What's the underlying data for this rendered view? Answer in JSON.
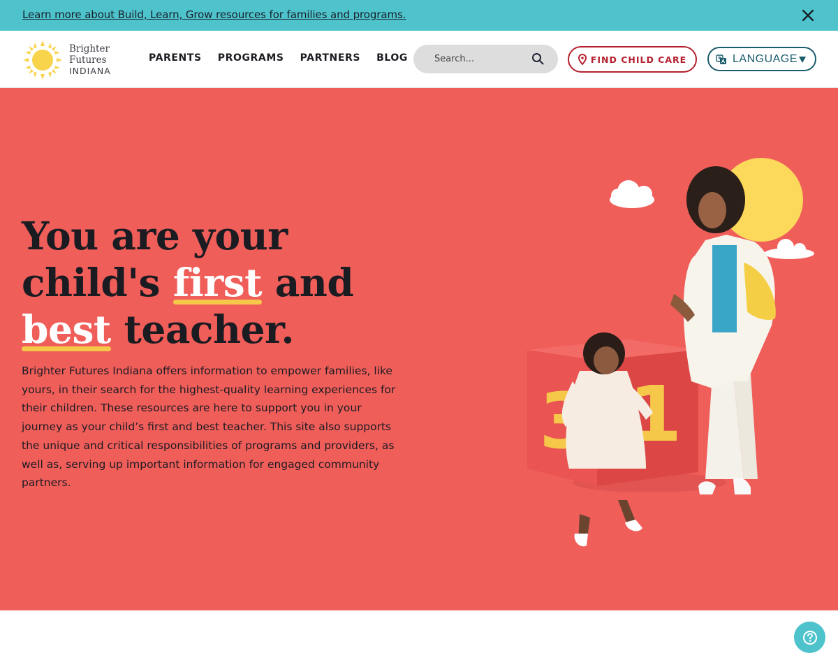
{
  "announcement": {
    "text": "Learn more about Build, Learn, Grow resources for families and programs."
  },
  "logo": {
    "line1": "Brighter",
    "line2": "Futures",
    "line3": "INDIANA"
  },
  "nav": {
    "items": [
      {
        "label": "PARENTS"
      },
      {
        "label": "PROGRAMS"
      },
      {
        "label": "PARTNERS"
      },
      {
        "label": "BLOG"
      }
    ]
  },
  "search": {
    "placeholder": "Search..."
  },
  "actions": {
    "find_care_label": "FIND CHILD CARE",
    "language_label": "LANGUAGE"
  },
  "hero": {
    "headline": {
      "part1": "You are your",
      "part2": "child's",
      "highlight1": "first",
      "part3": "and",
      "highlight2": "best",
      "part4": "teacher."
    },
    "intro": "Brighter Futures Indiana offers information to empower families, like yours, in their search for the highest-quality learning experiences for their children. These resources are here to support you in your journey as your child’s first and best teacher. This site also supports the unique and critical responsibilities of programs and providers, as well as, serving up important information for engaged community partners.",
    "block_numbers": [
      "3",
      "1"
    ]
  },
  "colors": {
    "announcement_bg": "#4fc3cc",
    "hero_bg": "#f05e5a",
    "accent_yellow": "#f6c84a",
    "find_care": "#b5202e",
    "language": "#1a5c6c"
  },
  "icons": {
    "close": "close-icon",
    "search": "search-icon",
    "location": "location-pin-icon",
    "translate": "translate-icon",
    "dropdown": "caret-down-icon",
    "help": "help-icon"
  }
}
